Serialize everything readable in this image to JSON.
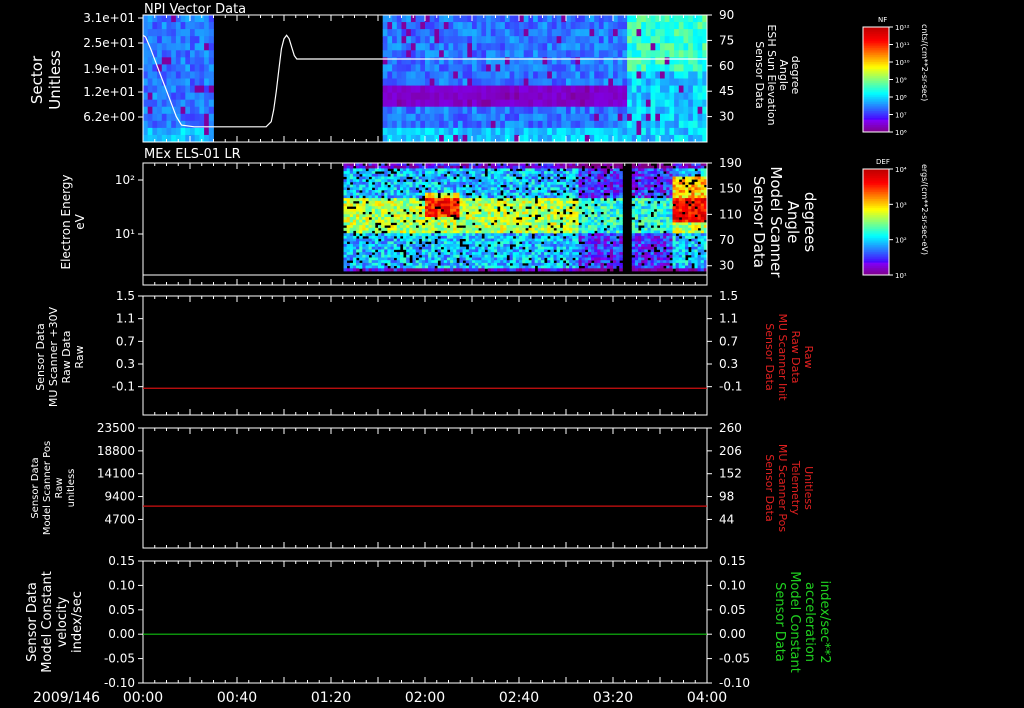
{
  "date_label": "2009/146",
  "time_ticks": [
    "00:00",
    "00:40",
    "01:20",
    "02:00",
    "02:40",
    "03:20",
    "04:00"
  ],
  "colors": {
    "axis": "#ffffff",
    "red_line": "#d01010",
    "green_line": "#10c010",
    "red_text": "#e02020",
    "green_text": "#20d020",
    "background": "#000000"
  },
  "colorbars": [
    {
      "title": "NF",
      "unit": "cnts/(cm**2-sr-sec)",
      "ticks": [
        "10¹²",
        "10¹¹",
        "10¹⁰",
        "10⁹",
        "10⁸",
        "10⁷",
        "10⁶"
      ]
    },
    {
      "title": "DEF",
      "unit": "ergs/(cm**2-sr-sec-eV)",
      "ticks": [
        "10⁴",
        "10³",
        "10²",
        "10¹"
      ]
    }
  ],
  "chart_data": [
    {
      "type": "heatmap",
      "title": "NPI Vector Data",
      "ylabel": [
        "Sector",
        "Unitless"
      ],
      "ytick_labels": [
        "3.1e+01",
        "2.5e+01",
        "1.9e+01",
        "1.2e+01",
        "6.2e+00"
      ],
      "xlim": [
        0,
        240
      ],
      "data_gap_minutes": [
        31,
        102
      ],
      "right_axis": {
        "label": [
          "Sensor Data",
          "ESH Sun Elevation",
          "Angle",
          "degree"
        ],
        "ticks": [
          90,
          75,
          60,
          45,
          30
        ],
        "ylim": [
          15,
          90
        ]
      },
      "line_series": {
        "color": "white",
        "x": [
          0,
          2,
          6,
          10,
          14,
          18,
          22,
          26,
          30,
          40,
          60,
          80,
          96,
          100,
          102,
          104,
          106,
          108,
          110,
          112,
          114,
          116,
          118,
          120,
          122,
          124,
          126,
          130,
          140,
          160,
          180,
          190,
          200,
          205,
          210,
          215,
          220,
          226,
          232,
          236,
          240,
          244,
          250,
          260,
          270,
          280,
          290,
          300,
          310,
          320,
          330,
          340,
          350,
          360,
          370,
          380,
          390,
          400,
          410,
          420,
          430,
          440
        ],
        "y": [
          78,
          77,
          70,
          62,
          54,
          46,
          38,
          30,
          25,
          24,
          24,
          24,
          24,
          27,
          34,
          45,
          58,
          70,
          76,
          78,
          76,
          71,
          66,
          64,
          64,
          64,
          64,
          64,
          64,
          64,
          64,
          64,
          64,
          64,
          64,
          64,
          64,
          64,
          64,
          64,
          64,
          64,
          64,
          64,
          64,
          64,
          64,
          64,
          64,
          64,
          64,
          64,
          64,
          64,
          64,
          64,
          64,
          64,
          64,
          64,
          64,
          64
        ]
      }
    },
    {
      "type": "heatmap",
      "title": "MEx ELS-01 LR",
      "ylabel": [
        "Electron Energy",
        "eV"
      ],
      "ytick_labels": [
        "10²",
        "10¹"
      ],
      "xlim": [
        0,
        240
      ],
      "data_start_minute": 86,
      "right_axis": {
        "label": [
          "Sensor Data",
          "Model Scanner",
          "Angle",
          "degrees"
        ],
        "ticks": [
          190,
          150,
          110,
          70,
          30
        ],
        "ylim": [
          0,
          190
        ]
      },
      "baseline_value": 0
    },
    {
      "type": "line",
      "ylabel": [
        "Sensor Data",
        "MU Scanner +30V",
        "Raw Data",
        "Raw"
      ],
      "ytick_labels": [
        "1.5",
        "1.1",
        "0.7",
        "0.3",
        "-0.1"
      ],
      "ylim": [
        -0.5,
        1.5
      ],
      "xlim": [
        0,
        240
      ],
      "series": [
        {
          "color": "red",
          "y": -0.05
        }
      ],
      "right_axis": {
        "label": [
          "Sensor Data",
          "MU Scanner Init",
          "Raw Data",
          "Raw"
        ],
        "ticks": [
          "1.5",
          "1.1",
          "0.7",
          "0.3",
          "-0.1"
        ],
        "color": "red"
      }
    },
    {
      "type": "line",
      "ylabel": [
        "Sensor Data",
        "Model Scanner Pos",
        "Raw",
        "unitless"
      ],
      "ytick_labels": [
        "23500",
        "18800",
        "14100",
        "9400",
        "4700"
      ],
      "ylim": [
        0,
        23500
      ],
      "xlim": [
        0,
        240
      ],
      "series": [
        {
          "color": "red",
          "y": 8200
        }
      ],
      "right_axis": {
        "label": [
          "Sensor Data",
          "MU Scanner Pos",
          "Telemetry",
          "Unitless"
        ],
        "ticks": [
          "260",
          "206",
          "152",
          "98",
          "44"
        ],
        "color": "red"
      }
    },
    {
      "type": "line",
      "ylabel": [
        "Sensor Data",
        "Model Constant",
        "velocity",
        "index/sec"
      ],
      "ytick_labels": [
        "0.15",
        "0.10",
        "0.05",
        "0.00",
        "-0.05",
        "-0.10"
      ],
      "ylim": [
        -0.1,
        0.15
      ],
      "xlim": [
        0,
        240
      ],
      "series": [
        {
          "color": "green",
          "y": 0.0
        }
      ],
      "right_axis": {
        "label": [
          "Sensor Data",
          "Model Constant",
          "acceleration",
          "index/sec**2"
        ],
        "ticks": [
          "0.15",
          "0.10",
          "0.05",
          "0.00",
          "-0.05",
          "-0.10"
        ],
        "color": "green"
      }
    }
  ]
}
